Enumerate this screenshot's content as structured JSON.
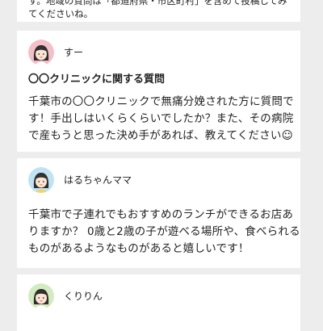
{
  "notice": {
    "text": "す。地域の質問は「都道府県・市区町村」を含めて投稿してみてくださいね。"
  },
  "posts": [
    {
      "username": "すー",
      "title": "〇〇クリニックに関する質問",
      "body": "千葉市の〇〇クリニックで無痛分娩された方に質問です！手出しはいくらくらいでしたか？また、その病院で産もうと思った決め手があれば、教えてください☺",
      "avatar": {
        "frame": "#f3c0c8",
        "hair": "#2e2e2e",
        "skin": "#fde3d2"
      }
    },
    {
      "username": "はるちゃんママ",
      "title": "",
      "body": "千葉市で子連れでもおすすめのランチができるお店ありますか？ 0歳と2歳の子が遊べる場所や、食べられるものがあるようなものがあると嬉しいです！",
      "avatar": {
        "frame": "#bfe3f3",
        "hair": "#2e2e2e",
        "skin": "#fde3d2"
      }
    },
    {
      "username": "くりりん",
      "title": "",
      "body": "",
      "avatar": {
        "frame": "#d3ebc0",
        "hair": "#2e2e2e",
        "skin": "#fde3d2"
      }
    }
  ]
}
